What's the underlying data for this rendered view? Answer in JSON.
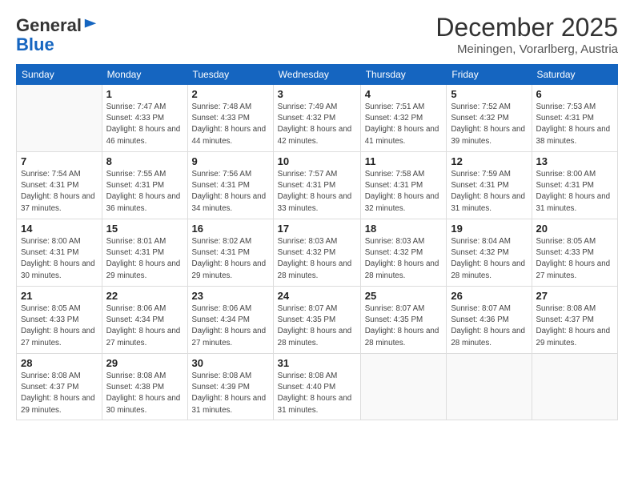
{
  "logo": {
    "general": "General",
    "blue": "Blue"
  },
  "title": "December 2025",
  "location": "Meiningen, Vorarlberg, Austria",
  "weekdays": [
    "Sunday",
    "Monday",
    "Tuesday",
    "Wednesday",
    "Thursday",
    "Friday",
    "Saturday"
  ],
  "weeks": [
    [
      {
        "day": null
      },
      {
        "day": "1",
        "sunrise": "7:47 AM",
        "sunset": "4:33 PM",
        "daylight": "8 hours and 46 minutes."
      },
      {
        "day": "2",
        "sunrise": "7:48 AM",
        "sunset": "4:33 PM",
        "daylight": "8 hours and 44 minutes."
      },
      {
        "day": "3",
        "sunrise": "7:49 AM",
        "sunset": "4:32 PM",
        "daylight": "8 hours and 42 minutes."
      },
      {
        "day": "4",
        "sunrise": "7:51 AM",
        "sunset": "4:32 PM",
        "daylight": "8 hours and 41 minutes."
      },
      {
        "day": "5",
        "sunrise": "7:52 AM",
        "sunset": "4:32 PM",
        "daylight": "8 hours and 39 minutes."
      },
      {
        "day": "6",
        "sunrise": "7:53 AM",
        "sunset": "4:31 PM",
        "daylight": "8 hours and 38 minutes."
      }
    ],
    [
      {
        "day": "7",
        "sunrise": "7:54 AM",
        "sunset": "4:31 PM",
        "daylight": "8 hours and 37 minutes."
      },
      {
        "day": "8",
        "sunrise": "7:55 AM",
        "sunset": "4:31 PM",
        "daylight": "8 hours and 36 minutes."
      },
      {
        "day": "9",
        "sunrise": "7:56 AM",
        "sunset": "4:31 PM",
        "daylight": "8 hours and 34 minutes."
      },
      {
        "day": "10",
        "sunrise": "7:57 AM",
        "sunset": "4:31 PM",
        "daylight": "8 hours and 33 minutes."
      },
      {
        "day": "11",
        "sunrise": "7:58 AM",
        "sunset": "4:31 PM",
        "daylight": "8 hours and 32 minutes."
      },
      {
        "day": "12",
        "sunrise": "7:59 AM",
        "sunset": "4:31 PM",
        "daylight": "8 hours and 31 minutes."
      },
      {
        "day": "13",
        "sunrise": "8:00 AM",
        "sunset": "4:31 PM",
        "daylight": "8 hours and 31 minutes."
      }
    ],
    [
      {
        "day": "14",
        "sunrise": "8:00 AM",
        "sunset": "4:31 PM",
        "daylight": "8 hours and 30 minutes."
      },
      {
        "day": "15",
        "sunrise": "8:01 AM",
        "sunset": "4:31 PM",
        "daylight": "8 hours and 29 minutes."
      },
      {
        "day": "16",
        "sunrise": "8:02 AM",
        "sunset": "4:31 PM",
        "daylight": "8 hours and 29 minutes."
      },
      {
        "day": "17",
        "sunrise": "8:03 AM",
        "sunset": "4:32 PM",
        "daylight": "8 hours and 28 minutes."
      },
      {
        "day": "18",
        "sunrise": "8:03 AM",
        "sunset": "4:32 PM",
        "daylight": "8 hours and 28 minutes."
      },
      {
        "day": "19",
        "sunrise": "8:04 AM",
        "sunset": "4:32 PM",
        "daylight": "8 hours and 28 minutes."
      },
      {
        "day": "20",
        "sunrise": "8:05 AM",
        "sunset": "4:33 PM",
        "daylight": "8 hours and 27 minutes."
      }
    ],
    [
      {
        "day": "21",
        "sunrise": "8:05 AM",
        "sunset": "4:33 PM",
        "daylight": "8 hours and 27 minutes."
      },
      {
        "day": "22",
        "sunrise": "8:06 AM",
        "sunset": "4:34 PM",
        "daylight": "8 hours and 27 minutes."
      },
      {
        "day": "23",
        "sunrise": "8:06 AM",
        "sunset": "4:34 PM",
        "daylight": "8 hours and 27 minutes."
      },
      {
        "day": "24",
        "sunrise": "8:07 AM",
        "sunset": "4:35 PM",
        "daylight": "8 hours and 28 minutes."
      },
      {
        "day": "25",
        "sunrise": "8:07 AM",
        "sunset": "4:35 PM",
        "daylight": "8 hours and 28 minutes."
      },
      {
        "day": "26",
        "sunrise": "8:07 AM",
        "sunset": "4:36 PM",
        "daylight": "8 hours and 28 minutes."
      },
      {
        "day": "27",
        "sunrise": "8:08 AM",
        "sunset": "4:37 PM",
        "daylight": "8 hours and 29 minutes."
      }
    ],
    [
      {
        "day": "28",
        "sunrise": "8:08 AM",
        "sunset": "4:37 PM",
        "daylight": "8 hours and 29 minutes."
      },
      {
        "day": "29",
        "sunrise": "8:08 AM",
        "sunset": "4:38 PM",
        "daylight": "8 hours and 30 minutes."
      },
      {
        "day": "30",
        "sunrise": "8:08 AM",
        "sunset": "4:39 PM",
        "daylight": "8 hours and 31 minutes."
      },
      {
        "day": "31",
        "sunrise": "8:08 AM",
        "sunset": "4:40 PM",
        "daylight": "8 hours and 31 minutes."
      },
      {
        "day": null
      },
      {
        "day": null
      },
      {
        "day": null
      }
    ]
  ]
}
